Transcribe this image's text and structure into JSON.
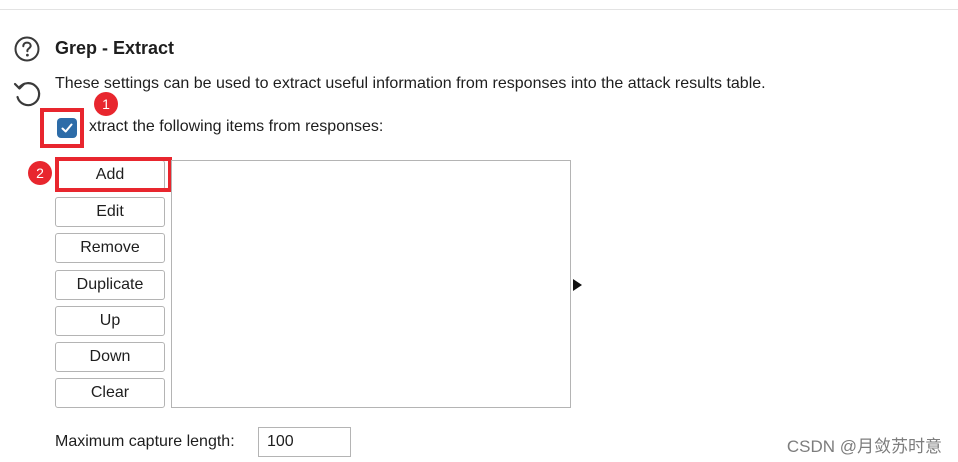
{
  "section": {
    "title": "Grep - Extract",
    "description": "These settings can be used to extract useful information from responses into the attack results table.",
    "help_icon": "help-circle-icon",
    "reset_icon": "restore-defaults-icon"
  },
  "extract_checkbox": {
    "label": "xtract the following items from responses:",
    "checked": true
  },
  "annotations": {
    "badge_1": "1",
    "badge_2": "2",
    "color": "#e8262e"
  },
  "buttons": {
    "add": "Add",
    "edit": "Edit",
    "remove": "Remove",
    "duplicate": "Duplicate",
    "up": "Up",
    "down": "Down",
    "clear": "Clear"
  },
  "extract_list": {
    "items": []
  },
  "max_capture": {
    "label": "Maximum capture length:",
    "value": "100"
  },
  "watermark": "CSDN @月敛苏时意",
  "colors": {
    "accent": "#2d6ca8",
    "highlight": "#e8262e"
  }
}
